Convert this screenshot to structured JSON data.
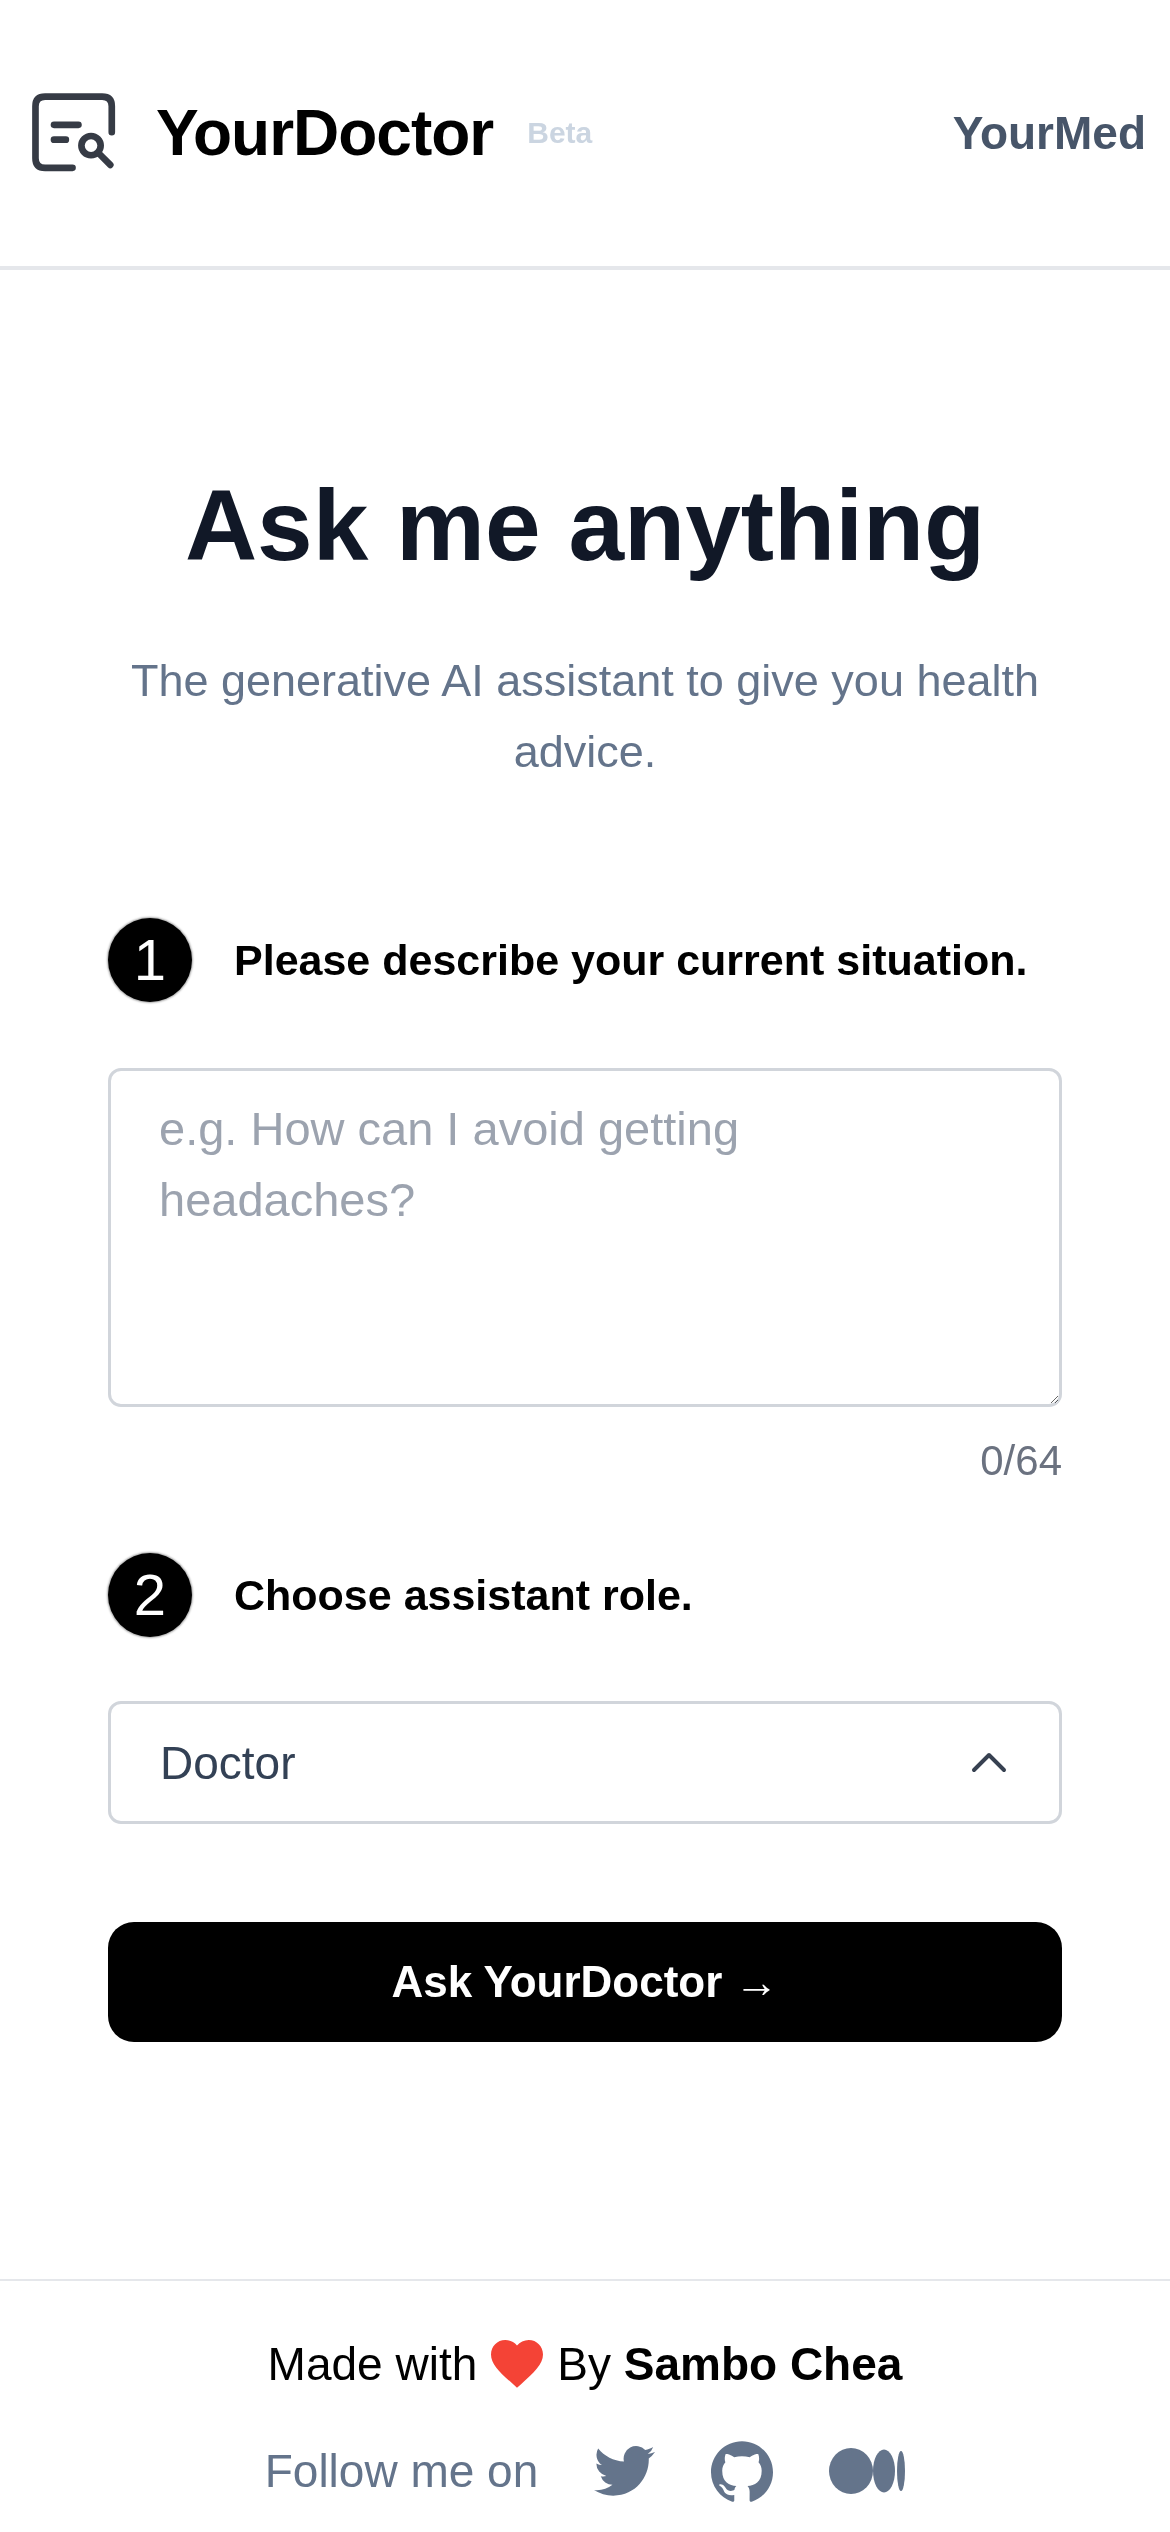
{
  "header": {
    "title": "YourDoctor",
    "badge": "Beta",
    "link": "YourMed"
  },
  "hero": {
    "title": "Ask me anything",
    "subtitle": "The generative AI assistant to give you health advice."
  },
  "steps": [
    {
      "kind": "textarea",
      "number": "1",
      "label": "Please describe your current situation.",
      "placeholder": "e.g. How can I avoid getting headaches?",
      "counter": "0/64"
    },
    {
      "kind": "select",
      "number": "2",
      "label": "Choose assistant role.",
      "value": "Doctor"
    }
  ],
  "submit_button": "Ask YourDoctor →",
  "footer": {
    "credit_prefix": "Made with",
    "credit": "By **Sambo Chea**",
    "follow_label": "Follow me on",
    "social_links": [
      {
        "kind": "twitter"
      },
      {
        "kind": "github"
      },
      {
        "kind": "medium"
      }
    ]
  }
}
